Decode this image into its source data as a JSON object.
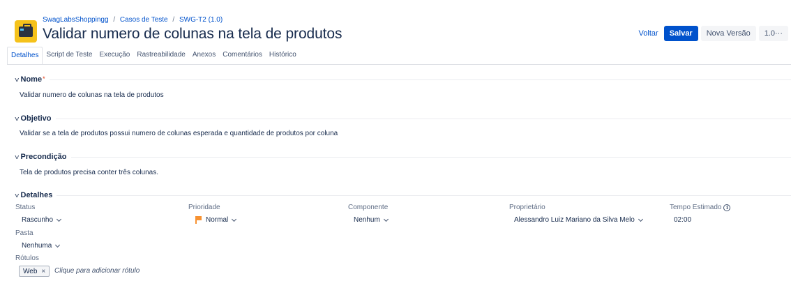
{
  "breadcrumb": {
    "project": "SwagLabsShoppingg",
    "sep1": "/",
    "folder": "Casos de Teste",
    "sep2": "/",
    "item": "SWG-T2 (1.0)"
  },
  "title": "Validar numero de colunas na tela de produtos",
  "actions": {
    "back": "Voltar",
    "save": "Salvar",
    "new_version": "Nova Versão",
    "version": "1.0",
    "more": "···"
  },
  "tabs": [
    {
      "label": "Detalhes",
      "active": true
    },
    {
      "label": "Script de Teste",
      "active": false
    },
    {
      "label": "Execução",
      "active": false
    },
    {
      "label": "Rastreabilidade",
      "active": false
    },
    {
      "label": "Anexos",
      "active": false
    },
    {
      "label": "Comentários",
      "active": false
    },
    {
      "label": "Histórico",
      "active": false
    }
  ],
  "sections": {
    "name": {
      "title": "Nome",
      "required_mark": "*",
      "value": "Validar numero de colunas na tela de produtos"
    },
    "objective": {
      "title": "Objetivo",
      "value": "Validar se a tela de produtos possui numero de colunas esperada e quantidade de produtos por coluna"
    },
    "precondition": {
      "title": "Precondição",
      "value": "Tela de produtos precisa conter três colunas."
    },
    "details": {
      "title": "Detalhes"
    }
  },
  "details": {
    "status": {
      "label": "Status",
      "value": "Rascunho"
    },
    "priority": {
      "label": "Prioridade",
      "value": "Normal",
      "color": "#f79232"
    },
    "component": {
      "label": "Componente",
      "value": "Nenhum"
    },
    "owner": {
      "label": "Proprietário",
      "value": "Alessandro Luiz Mariano da Silva Melo"
    },
    "estimated_time": {
      "label": "Tempo Estimado",
      "value": "02:00"
    },
    "folder": {
      "label": "Pasta",
      "value": "Nenhuma"
    },
    "labels": {
      "label": "Rótulos",
      "tags": [
        "Web"
      ],
      "remove_glyph": "×",
      "add_placeholder": "Clique para adicionar rótulo"
    }
  },
  "icons": {
    "info": "i",
    "chevron": "v"
  },
  "colors": {
    "accent": "#0052cc",
    "project_avatar": "#f5c21b",
    "required": "#de350b"
  }
}
